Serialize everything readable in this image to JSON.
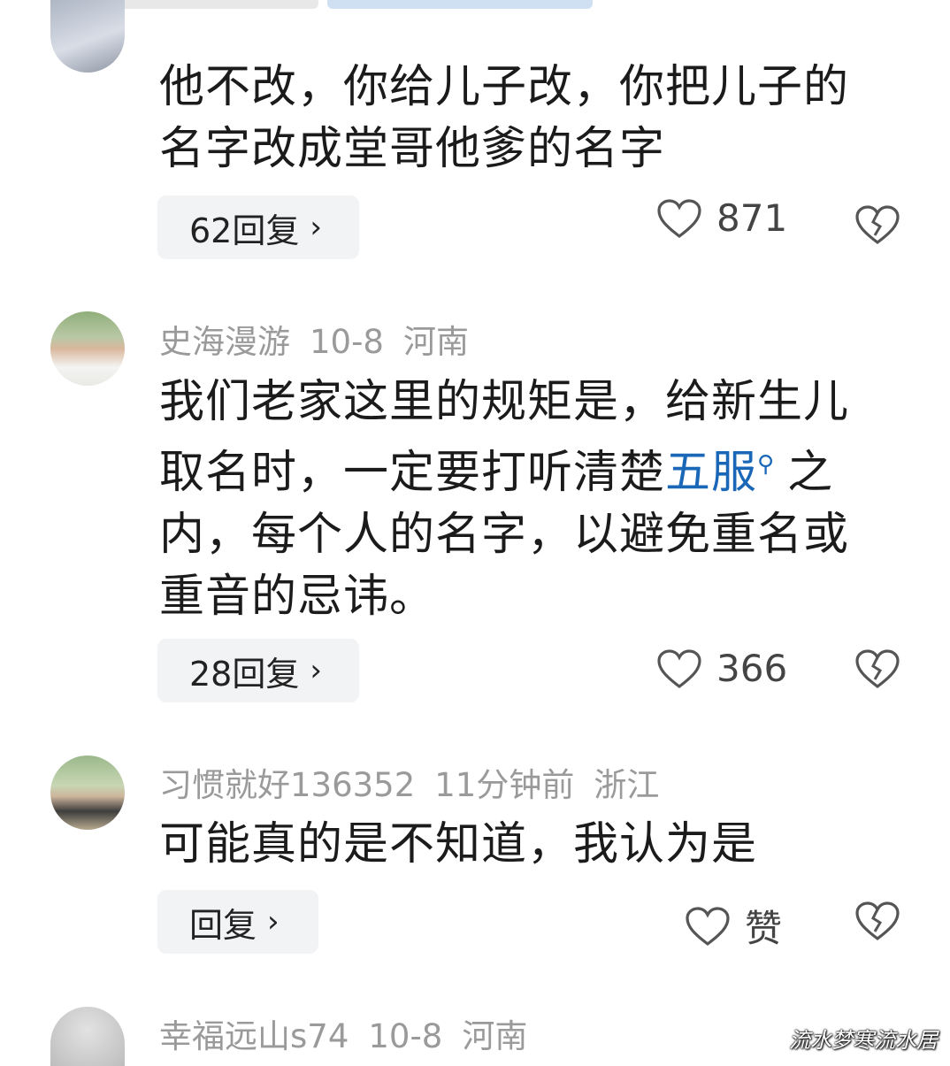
{
  "comments": [
    {
      "text": "他不改，你给儿子改，你把儿子的名字改成堂哥他爹的名字",
      "replies_label": "62回复",
      "likes": "871"
    },
    {
      "user": "史海漫游",
      "time": "10-8",
      "location": "河南",
      "text_before_link": "我们老家这里的规矩是，给新生儿取名时，一定要打听清楚",
      "link_text": "五服",
      "text_after_link": "之内，每个人的名字，以避免重名或重音的忌讳。",
      "replies_label": "28回复",
      "likes": "366"
    },
    {
      "user": "习惯就好136352",
      "time": "11分钟前",
      "location": "浙江",
      "text": "可能真的是不知道，我认为是",
      "replies_label": "回复",
      "likes": "赞"
    },
    {
      "user": "幸福远山s74",
      "time": "10-8",
      "location": "河南"
    }
  ],
  "icons": {
    "reply_chevron": "chevron-right-icon",
    "like": "heart-outline-icon",
    "dislike": "broken-heart-icon",
    "link_search": "search-icon"
  },
  "colors": {
    "link": "#1a67b8",
    "meta": "#9a9a9a",
    "button_bg": "#f2f3f5"
  },
  "watermark": "流水梦寒流水居"
}
